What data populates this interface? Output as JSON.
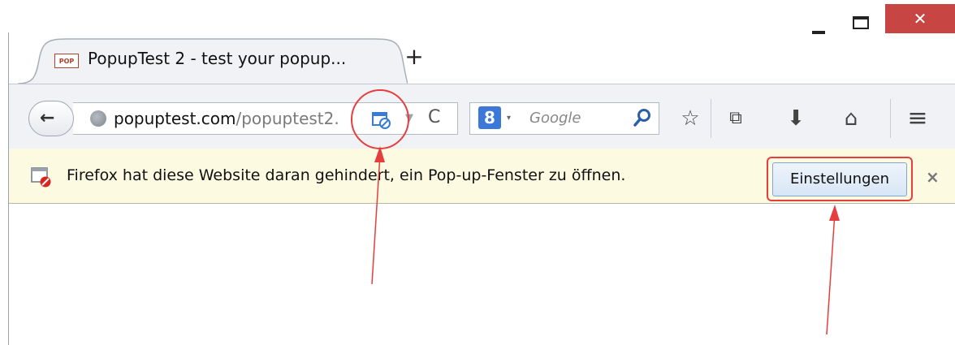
{
  "tab": {
    "favicon_text": "POP",
    "title": "PopupTest 2 - test your popup..."
  },
  "newtab": {
    "label": "+"
  },
  "window": {
    "close_label": "✕"
  },
  "navbar": {
    "url_host": "popuptest.com",
    "url_path": "/popuptest2.",
    "search_engine_letter": "8",
    "search_placeholder": "Google"
  },
  "icons": {
    "back": "←",
    "reload": "C",
    "dropdown": "▼",
    "bookmark_star": "☆",
    "bookmarks_menu": "⧉",
    "downloads": "⬇",
    "home": "⌂",
    "menu": "≡",
    "search_dropdown": "▾"
  },
  "notification": {
    "text": "Firefox hat diese Website daran gehindert, ein Pop-up-Fenster zu öffnen.",
    "button_label": "Einstellungen",
    "close_label": "×"
  },
  "colors": {
    "annotation_red": "#e63e3e",
    "close_button": "#c74543",
    "notification_bg": "#fcfbe2"
  }
}
